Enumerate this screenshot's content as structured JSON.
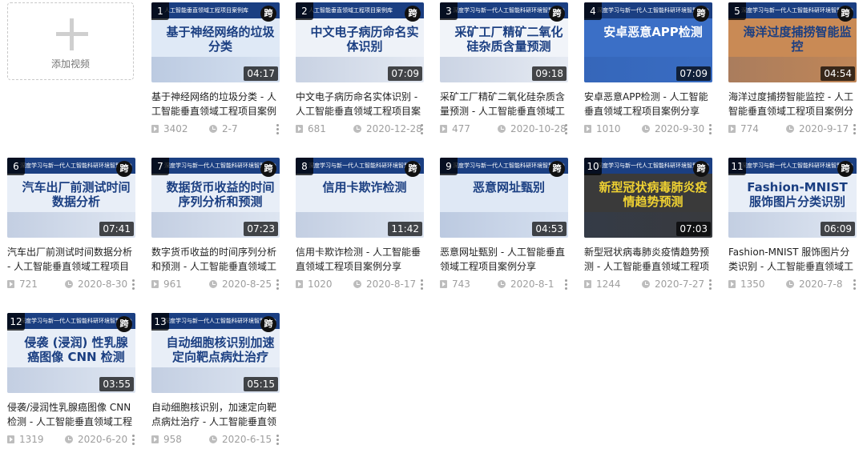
{
  "add_video": {
    "label": "添加视频"
  },
  "videos": [
    {
      "index": "1",
      "cross": "跨",
      "band": "人工智能垂直领域工程项目案例库",
      "art": "基于神经网络的垃圾分类",
      "duration": "04:17",
      "title": "基于神经网络的垃圾分类 - 人工智能垂直领域工程项目案例",
      "views": "3402",
      "date": "2-7",
      "colors": {
        "bg": "#dfe9f6",
        "art": "#1b3f82"
      }
    },
    {
      "index": "2",
      "cross": "跨",
      "band": "人工智能垂直领域工程项目案例库",
      "art": "中文电子病历命名实体识别",
      "duration": "07:09",
      "title": "中文电子病历命名实体识别 - 人工智能垂直领域工程项目案",
      "views": "681",
      "date": "2020-12-28",
      "colors": {
        "bg": "#eef2f8",
        "art": "#1b3f82"
      }
    },
    {
      "index": "3",
      "cross": "跨",
      "band": "深度学习与新一代人工智能科研环境智慧平台",
      "art": "采矿工厂精矿二氧化硅杂质含量预测",
      "duration": "09:18",
      "title": "采矿工厂精矿二氧化硅杂质含量预测 - 人工智能垂直领域工",
      "views": "477",
      "date": "2020-10-28",
      "colors": {
        "bg": "#f1f4f9",
        "art": "#1b3f82"
      }
    },
    {
      "index": "4",
      "cross": "跨",
      "band": "深度学习与新一代人工智能科研环境智慧平台",
      "art": "安卓恶意APP检测",
      "duration": "07:09",
      "title": "安卓恶意APP检测 - 人工智能垂直领域工程项目案例分享",
      "views": "1010",
      "date": "2020-9-30",
      "colors": {
        "bg": "#3b6fc6",
        "art": "#ffffff"
      }
    },
    {
      "index": "5",
      "cross": "跨",
      "band": "深度学习与新一代人工智能科研环境智慧平台",
      "art": "海洋过度捕捞智能监控",
      "duration": "04:54",
      "title": "海洋过度捕捞智能监控 - 人工智能垂直领域工程项目案例分",
      "views": "774",
      "date": "2020-9-17",
      "colors": {
        "bg": "#c98a55",
        "art": "#1b3f82"
      }
    },
    {
      "index": "6",
      "cross": "跨",
      "band": "深度学习与新一代人工智能科研环境智慧平台",
      "art": "汽车出厂前测试时间数据分析",
      "duration": "07:41",
      "title": "汽车出厂前测试时间数据分析 - 人工智能垂直领域工程项目",
      "views": "721",
      "date": "2020-8-30",
      "colors": {
        "bg": "#e8eef7",
        "art": "#1b3f82"
      }
    },
    {
      "index": "7",
      "cross": "跨",
      "band": "深度学习与新一代人工智能科研环境智慧平台",
      "art": "数据货币收益的时间序列分析和预测",
      "duration": "07:23",
      "title": "数字货币收益的时间序列分析和预测 - 人工智能垂直领域工",
      "views": "961",
      "date": "2020-8-25",
      "colors": {
        "bg": "#e8eef7",
        "art": "#1b3f82"
      }
    },
    {
      "index": "8",
      "cross": "跨",
      "band": "深度学习与新一代人工智能科研环境智慧平台",
      "art": "信用卡欺诈检测",
      "duration": "11:42",
      "title": "信用卡欺诈检测 - 人工智能垂直领域工程项目案例分享",
      "views": "1020",
      "date": "2020-8-17",
      "colors": {
        "bg": "#e8eef7",
        "art": "#1b3f82"
      }
    },
    {
      "index": "9",
      "cross": "跨",
      "band": "深度学习与新一代人工智能科研环境智慧平台",
      "art": "恶意网址甄别",
      "duration": "04:53",
      "title": "恶意网址甄别 - 人工智能垂直领域工程项目案例分享",
      "views": "743",
      "date": "2020-8-1",
      "colors": {
        "bg": "#dfe8f5",
        "art": "#1b3f82"
      }
    },
    {
      "index": "10",
      "cross": "跨",
      "band": "深度学习与新一代人工智能科研环境智慧平台",
      "art": "新型冠状病毒肺炎疫情趋势预测",
      "duration": "07:03",
      "title": "新型冠状病毒肺炎疫情趋势预测 - 人工智能垂直领域工程项",
      "views": "1244",
      "date": "2020-7-27",
      "colors": {
        "bg": "#3a3a3a",
        "art": "#f0d232"
      }
    },
    {
      "index": "11",
      "cross": "跨",
      "band": "深度学习与新一代人工智能科研环境智慧平台",
      "art": "Fashion-MNIST 服饰图片分类识别",
      "duration": "06:09",
      "title": "Fashion-MNIST 服饰图片分类识别 - 人工智能垂直领域工",
      "views": "1350",
      "date": "2020-7-8",
      "colors": {
        "bg": "#e8eef7",
        "art": "#1b3f82"
      }
    },
    {
      "index": "12",
      "cross": "跨",
      "band": "深度学习与新一代人工智能科研环境智慧平台",
      "art": "侵袭 (浸润) 性乳腺癌图像 CNN 检测",
      "duration": "03:55",
      "title": "侵袭/浸润性乳腺癌图像 CNN 检测 - 人工智能垂直领域工程",
      "views": "1319",
      "date": "2020-6-20",
      "colors": {
        "bg": "#e8eef7",
        "art": "#1b3f82"
      }
    },
    {
      "index": "13",
      "cross": "跨",
      "band": "深度学习与新一代人工智能科研环境智慧平台",
      "art": "自动细胞核识别加速定向靶点病灶治疗",
      "duration": "05:15",
      "title": "自动细胞核识别，加速定向靶点病灶治疗 - 人工智能垂直领",
      "views": "958",
      "date": "2020-6-15",
      "colors": {
        "bg": "#e8eef7",
        "art": "#1b3f82"
      }
    }
  ]
}
